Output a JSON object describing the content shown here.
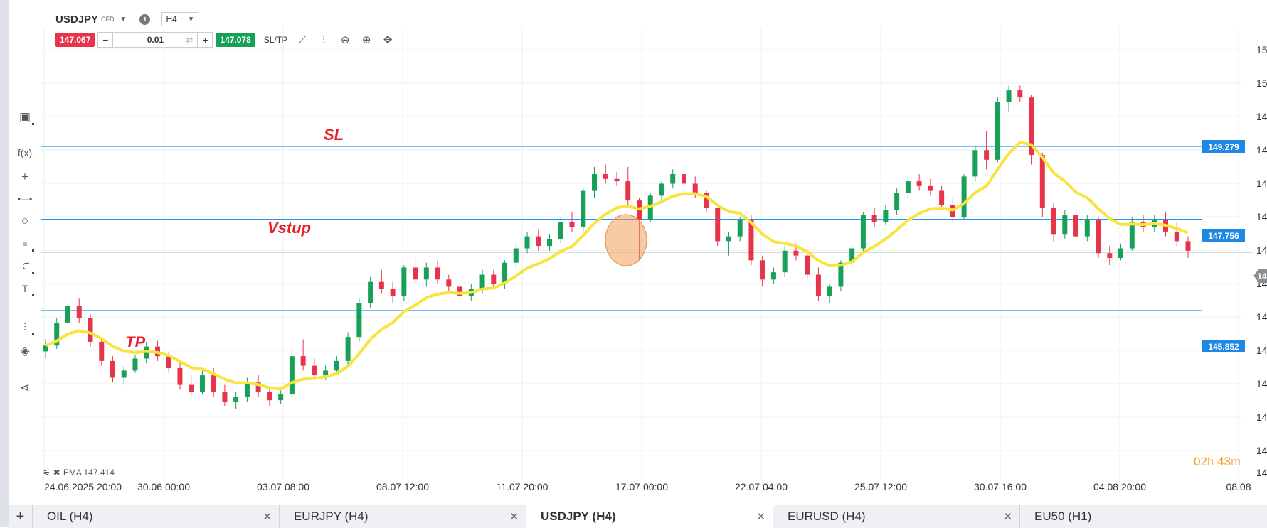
{
  "instrument": {
    "symbol": "USDJPY",
    "type": "CFD",
    "timeframe": "H4"
  },
  "trade": {
    "sell_price": "147.067",
    "buy_price": "147.078",
    "quantity": "0.01",
    "sl_tp_label": "SL/TP",
    "minus": "−",
    "plus": "+"
  },
  "toolbar_icons": [
    "line-chart-icon",
    "candles-icon",
    "zoom-out-icon",
    "zoom-in-icon",
    "move-icon"
  ],
  "left_tools": [
    "rectangle-icon",
    "function-icon",
    "crosshair-icon",
    "line-icon",
    "circle-icon",
    "fibonacci-icon",
    "pitchfork-icon",
    "text-icon",
    "indicators-icon",
    "layers-icon",
    "share-icon"
  ],
  "annotations": {
    "sl": "SL",
    "entry": "Vstup",
    "tp": "TP"
  },
  "levels": {
    "sl": "149.279",
    "entry": "147.756",
    "tp": "145.852",
    "current": "14"
  },
  "y_axis_labels": [
    "15",
    "15",
    "14",
    "14",
    "14",
    "14",
    "14",
    "14",
    "14",
    "14",
    "14",
    "14",
    "14",
    "14"
  ],
  "x_axis_labels": [
    "24.06.2025 20:00",
    "30.06 00:00",
    "03.07 08:00",
    "08.07 12:00",
    "11.07 20:00",
    "17.07 00:00",
    "22.07 04:00",
    "25.07 12:00",
    "30.07 16:00",
    "04.08 20:00",
    "08.08"
  ],
  "legend": {
    "ema": "EMA 147.414"
  },
  "timer": {
    "hours": "02",
    "h": "h",
    "minutes": "43",
    "m": "m"
  },
  "tabs": [
    {
      "label": "OIL (H4)",
      "active": false
    },
    {
      "label": "EURJPY (H4)",
      "active": false
    },
    {
      "label": "USDJPY (H4)",
      "active": true
    },
    {
      "label": "EURUSD (H4)",
      "active": false
    },
    {
      "label": "EU50 (H1)",
      "active": false
    }
  ],
  "colors": {
    "bull": "#18a058",
    "bear": "#e8344b",
    "ema": "#f8e43c",
    "level": "#2196f3",
    "annotation": "#e8202a"
  },
  "chart_data": {
    "type": "candlestick",
    "x_start": "24.06.2025 20:00",
    "x_end": "08.08",
    "ema": 147.414,
    "horizontal_lines": {
      "sl": 149.279,
      "entry": 147.756,
      "tp": 145.852,
      "current": 147.07
    },
    "candles_ohlc": [
      [
        145.0,
        145.25,
        144.85,
        145.12
      ],
      [
        145.12,
        145.7,
        145.05,
        145.6
      ],
      [
        145.6,
        146.05,
        145.45,
        145.95
      ],
      [
        145.95,
        146.1,
        145.6,
        145.7
      ],
      [
        145.7,
        145.78,
        145.1,
        145.2
      ],
      [
        145.2,
        145.3,
        144.7,
        144.8
      ],
      [
        144.8,
        144.9,
        144.35,
        144.45
      ],
      [
        144.45,
        144.7,
        144.3,
        144.6
      ],
      [
        144.6,
        144.92,
        144.55,
        144.85
      ],
      [
        144.85,
        145.2,
        144.75,
        145.1
      ],
      [
        145.1,
        145.22,
        144.8,
        144.9
      ],
      [
        144.9,
        145.0,
        144.55,
        144.65
      ],
      [
        144.65,
        144.8,
        144.2,
        144.3
      ],
      [
        144.3,
        144.5,
        144.05,
        144.15
      ],
      [
        144.15,
        144.6,
        144.1,
        144.5
      ],
      [
        144.5,
        144.65,
        144.05,
        144.15
      ],
      [
        144.15,
        144.3,
        143.85,
        143.95
      ],
      [
        143.95,
        144.15,
        143.8,
        144.05
      ],
      [
        144.05,
        144.45,
        143.95,
        144.35
      ],
      [
        144.35,
        144.5,
        144.05,
        144.15
      ],
      [
        144.15,
        144.25,
        143.85,
        143.98
      ],
      [
        143.98,
        144.2,
        143.9,
        144.1
      ],
      [
        144.1,
        145.05,
        144.05,
        144.9
      ],
      [
        144.9,
        145.25,
        144.6,
        144.7
      ],
      [
        144.7,
        144.85,
        144.4,
        144.5
      ],
      [
        144.5,
        144.7,
        144.4,
        144.6
      ],
      [
        144.6,
        144.9,
        144.55,
        144.8
      ],
      [
        144.8,
        145.4,
        144.7,
        145.3
      ],
      [
        145.3,
        146.1,
        145.2,
        146.0
      ],
      [
        146.0,
        146.55,
        145.9,
        146.45
      ],
      [
        146.45,
        146.7,
        146.2,
        146.3
      ],
      [
        146.3,
        146.45,
        146.0,
        146.15
      ],
      [
        146.15,
        146.8,
        146.05,
        146.75
      ],
      [
        146.75,
        146.95,
        146.4,
        146.5
      ],
      [
        146.5,
        146.85,
        146.35,
        146.75
      ],
      [
        146.75,
        146.9,
        146.4,
        146.5
      ],
      [
        146.5,
        146.6,
        146.2,
        146.35
      ],
      [
        146.35,
        146.55,
        146.05,
        146.15
      ],
      [
        146.15,
        146.4,
        146.05,
        146.3
      ],
      [
        146.3,
        146.7,
        146.2,
        146.6
      ],
      [
        146.6,
        146.7,
        146.3,
        146.4
      ],
      [
        146.4,
        146.9,
        146.3,
        146.85
      ],
      [
        146.85,
        147.25,
        146.75,
        147.15
      ],
      [
        147.15,
        147.5,
        147.05,
        147.4
      ],
      [
        147.4,
        147.55,
        147.1,
        147.2
      ],
      [
        147.2,
        147.45,
        147.1,
        147.35
      ],
      [
        147.35,
        147.8,
        147.25,
        147.7
      ],
      [
        147.7,
        147.9,
        147.5,
        147.6
      ],
      [
        147.6,
        148.4,
        147.5,
        148.35
      ],
      [
        148.35,
        148.85,
        148.2,
        148.7
      ],
      [
        148.7,
        148.9,
        148.5,
        148.6
      ],
      [
        148.6,
        148.75,
        148.45,
        148.55
      ],
      [
        148.55,
        148.85,
        148.0,
        148.15
      ],
      [
        148.15,
        148.2,
        146.9,
        147.75
      ],
      [
        147.75,
        148.3,
        147.7,
        148.25
      ],
      [
        148.25,
        148.55,
        148.1,
        148.5
      ],
      [
        148.5,
        148.8,
        148.4,
        148.7
      ],
      [
        148.7,
        148.75,
        148.4,
        148.5
      ],
      [
        148.5,
        148.65,
        148.2,
        148.3
      ],
      [
        148.3,
        148.35,
        147.9,
        148.0
      ],
      [
        148.0,
        147.95,
        147.2,
        147.3
      ],
      [
        147.3,
        147.5,
        147.0,
        147.4
      ],
      [
        147.4,
        147.8,
        147.3,
        147.75
      ],
      [
        147.75,
        147.85,
        146.8,
        146.9
      ],
      [
        146.9,
        147.0,
        146.35,
        146.5
      ],
      [
        146.5,
        146.75,
        146.4,
        146.65
      ],
      [
        146.65,
        147.2,
        146.55,
        147.1
      ],
      [
        147.1,
        147.25,
        146.9,
        147.0
      ],
      [
        147.0,
        147.1,
        146.5,
        146.6
      ],
      [
        146.6,
        146.75,
        146.05,
        146.15
      ],
      [
        146.15,
        146.4,
        146.0,
        146.35
      ],
      [
        146.35,
        146.9,
        146.25,
        146.85
      ],
      [
        146.85,
        147.25,
        146.75,
        147.15
      ],
      [
        147.15,
        147.9,
        147.05,
        147.85
      ],
      [
        147.85,
        148.0,
        147.6,
        147.7
      ],
      [
        147.7,
        148.05,
        147.65,
        147.95
      ],
      [
        147.95,
        148.4,
        147.85,
        148.3
      ],
      [
        148.3,
        148.65,
        148.2,
        148.55
      ],
      [
        148.55,
        148.7,
        148.35,
        148.45
      ],
      [
        148.45,
        148.6,
        148.25,
        148.35
      ],
      [
        148.35,
        148.45,
        147.95,
        148.05
      ],
      [
        148.05,
        148.2,
        147.7,
        147.8
      ],
      [
        147.8,
        148.7,
        147.75,
        148.65
      ],
      [
        148.65,
        149.3,
        148.55,
        149.2
      ],
      [
        149.2,
        149.6,
        148.8,
        149.0
      ],
      [
        149.0,
        150.3,
        148.95,
        150.2
      ],
      [
        150.2,
        150.55,
        150.0,
        150.45
      ],
      [
        150.45,
        150.55,
        150.2,
        150.3
      ],
      [
        150.3,
        150.35,
        148.9,
        149.1
      ],
      [
        149.1,
        149.15,
        147.8,
        148.0
      ],
      [
        148.0,
        148.1,
        147.3,
        147.45
      ],
      [
        147.45,
        147.95,
        147.35,
        147.85
      ],
      [
        147.85,
        147.95,
        147.3,
        147.4
      ],
      [
        147.4,
        147.85,
        147.3,
        147.75
      ],
      [
        147.75,
        147.8,
        146.95,
        147.05
      ],
      [
        147.05,
        147.2,
        146.8,
        146.95
      ],
      [
        146.95,
        147.25,
        146.9,
        147.15
      ],
      [
        147.15,
        147.8,
        147.1,
        147.7
      ],
      [
        147.7,
        147.85,
        147.5,
        147.6
      ],
      [
        147.6,
        147.85,
        147.5,
        147.75
      ],
      [
        147.75,
        147.9,
        147.4,
        147.5
      ],
      [
        147.5,
        147.7,
        147.2,
        147.3
      ],
      [
        147.3,
        147.4,
        146.95,
        147.1
      ]
    ]
  }
}
